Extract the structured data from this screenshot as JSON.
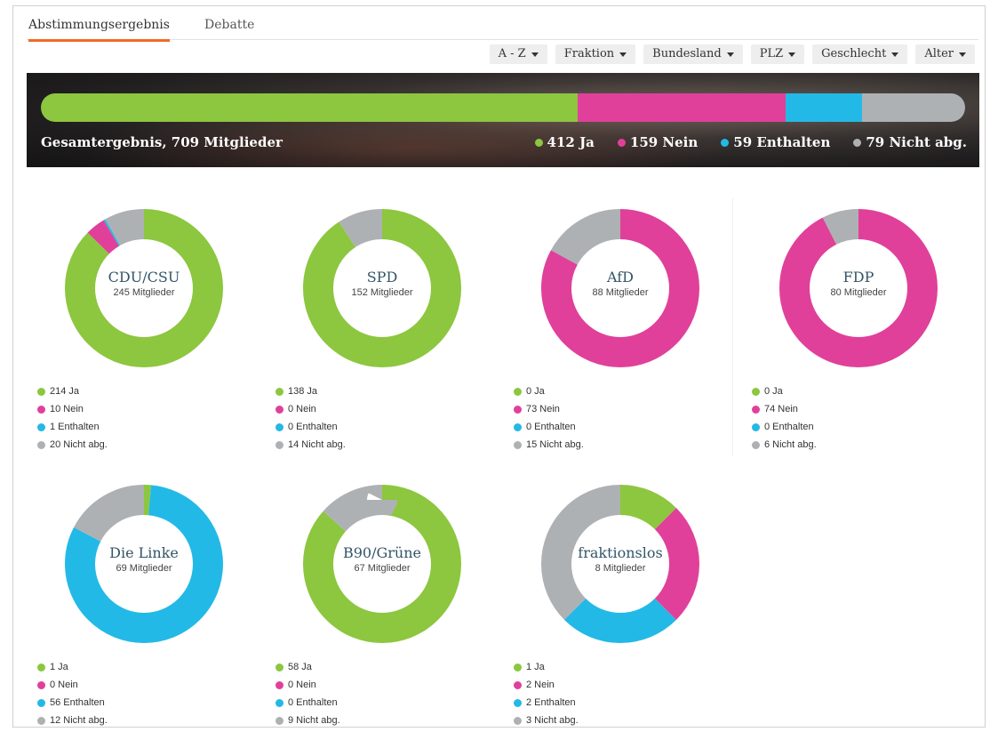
{
  "tabs": [
    {
      "label": "Abstimmungsergebnis"
    },
    {
      "label": "Debatte"
    }
  ],
  "filters": [
    {
      "label": "A - Z"
    },
    {
      "label": "Fraktion"
    },
    {
      "label": "Bundesland"
    },
    {
      "label": "PLZ"
    },
    {
      "label": "Geschlecht"
    },
    {
      "label": "Alter"
    }
  ],
  "colors": {
    "ja": "#8dc63f",
    "nein": "#e0409a",
    "enthalten": "#23b9e6",
    "nicht": "#aeb1b4"
  },
  "overall": {
    "title": "Gesamtergebnis, 709 Mitglieder",
    "values": {
      "ja": 412,
      "nein": 159,
      "enthalten": 59,
      "nicht": 79
    },
    "legend": {
      "ja": "412 Ja",
      "nein": "159 Nein",
      "enthalten": "59 Enthalten",
      "nicht": "79 Nicht abg."
    }
  },
  "parties": [
    {
      "name": "CDU/CSU",
      "members": "245 Mitglieder",
      "values": {
        "ja": 214,
        "nein": 10,
        "enthalten": 1,
        "nicht": 20
      },
      "legend": {
        "ja": "214 Ja",
        "nein": "10 Nein",
        "enthalten": "1 Enthalten",
        "nicht": "20 Nicht abg."
      }
    },
    {
      "name": "SPD",
      "members": "152 Mitglieder",
      "values": {
        "ja": 138,
        "nein": 0,
        "enthalten": 0,
        "nicht": 14
      },
      "legend": {
        "ja": "138 Ja",
        "nein": "0 Nein",
        "enthalten": "0 Enthalten",
        "nicht": "14 Nicht abg."
      }
    },
    {
      "name": "AfD",
      "members": "88 Mitglieder",
      "values": {
        "ja": 0,
        "nein": 73,
        "enthalten": 0,
        "nicht": 15
      },
      "legend": {
        "ja": "0 Ja",
        "nein": "73 Nein",
        "enthalten": "0 Enthalten",
        "nicht": "15 Nicht abg."
      }
    },
    {
      "name": "FDP",
      "members": "80 Mitglieder",
      "values": {
        "ja": 0,
        "nein": 74,
        "enthalten": 0,
        "nicht": 6
      },
      "legend": {
        "ja": "0 Ja",
        "nein": "74 Nein",
        "enthalten": "0 Enthalten",
        "nicht": "6 Nicht abg."
      }
    },
    {
      "name": "Die Linke",
      "members": "69 Mitglieder",
      "values": {
        "ja": 1,
        "nein": 0,
        "enthalten": 56,
        "nicht": 12
      },
      "legend": {
        "ja": "1 Ja",
        "nein": "0 Nein",
        "enthalten": "56 Enthalten",
        "nicht": "12 Nicht abg."
      }
    },
    {
      "name": "B90/Grüne",
      "members": "67 Mitglieder",
      "values": {
        "ja": 58,
        "nein": 0,
        "enthalten": 0,
        "nicht": 9
      },
      "legend": {
        "ja": "58 Ja",
        "nein": "0 Nein",
        "enthalten": "0 Enthalten",
        "nicht": "9 Nicht abg."
      }
    },
    {
      "name": "fraktionslos",
      "members": "8 Mitglieder",
      "values": {
        "ja": 1,
        "nein": 2,
        "enthalten": 2,
        "nicht": 3
      },
      "legend": {
        "ja": "1 Ja",
        "nein": "2 Nein",
        "enthalten": "2 Enthalten",
        "nicht": "3 Nicht abg."
      }
    }
  ]
}
